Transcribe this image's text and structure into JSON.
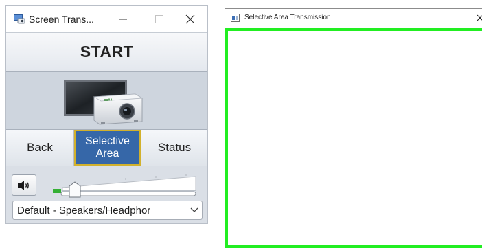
{
  "app_window": {
    "title": "Screen Trans...",
    "icons": {
      "app": "screen-transmission-icon",
      "minimize": "minimize-icon",
      "maximize": "maximize-icon",
      "close": "close-icon"
    },
    "start_label": "START",
    "device_icon": "display-and-projector-icon",
    "buttons": {
      "back": "Back",
      "selective_line1": "Selective",
      "selective_line2": "Area",
      "status": "Status"
    },
    "audio": {
      "mute_icon": "speaker-volume-icon",
      "volume_level": 0.06,
      "output_device": "Default - Speakers/Headphor"
    },
    "colors": {
      "selected_button": "#3667a8",
      "selected_border": "#d2b12c"
    }
  },
  "transmission_window": {
    "title": "Selective Area Transmission",
    "icons": {
      "app": "window-icon",
      "close": "close-icon"
    },
    "frame_color": "#22ee22"
  }
}
